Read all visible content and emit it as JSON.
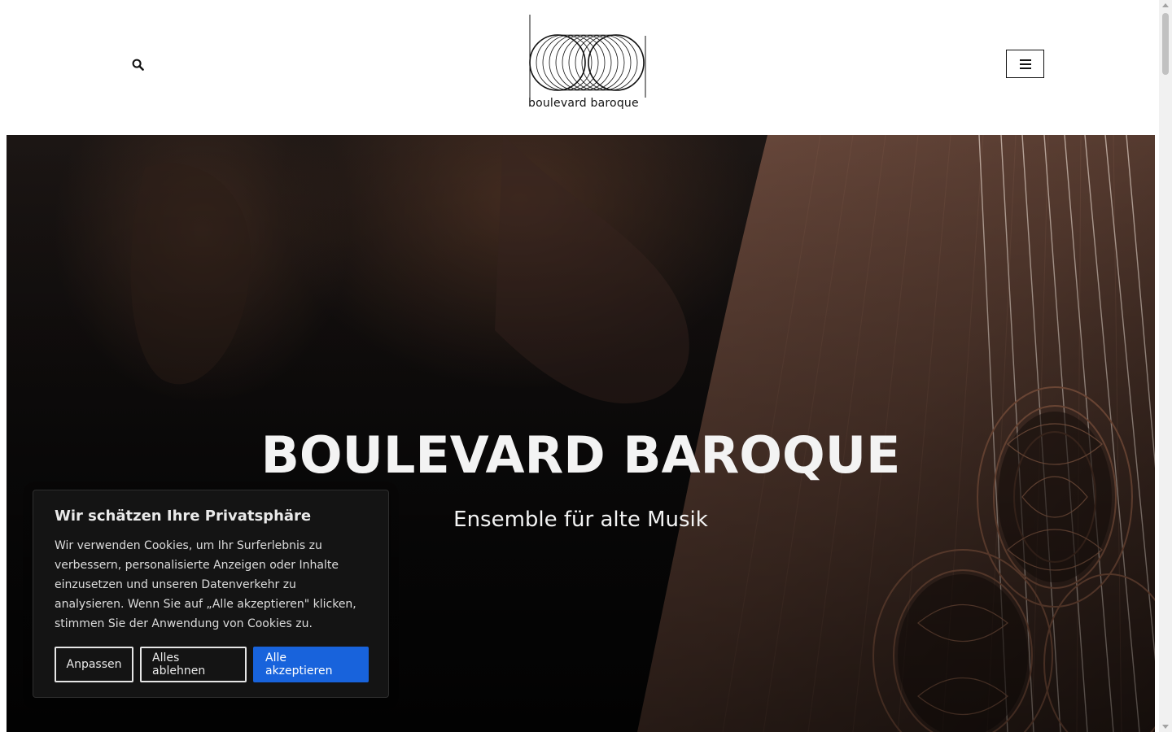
{
  "header": {
    "search_icon": "search-icon",
    "menu_icon": "hamburger-menu-icon",
    "logo": {
      "text": "boulevard baroque"
    }
  },
  "hero": {
    "title": "BOULEVARD BAROQUE",
    "subtitle": "Ensemble für alte Musik"
  },
  "cookie_banner": {
    "title": "Wir schätzen Ihre Privatsphäre",
    "text": "Wir verwenden Cookies, um Ihr Surferlebnis zu verbessern, personalisierte Anzeigen oder Inhalte einzusetzen und unseren Datenverkehr zu analysieren. Wenn Sie auf „Alle akzeptieren\" klicken, stimmen Sie der Anwendung von Cookies zu.",
    "buttons": {
      "customize": "Anpassen",
      "reject_all": "Alles ablehnen",
      "accept_all": "Alle akzeptieren"
    },
    "colors": {
      "background": "#141414",
      "accent": "#1863dc"
    }
  }
}
